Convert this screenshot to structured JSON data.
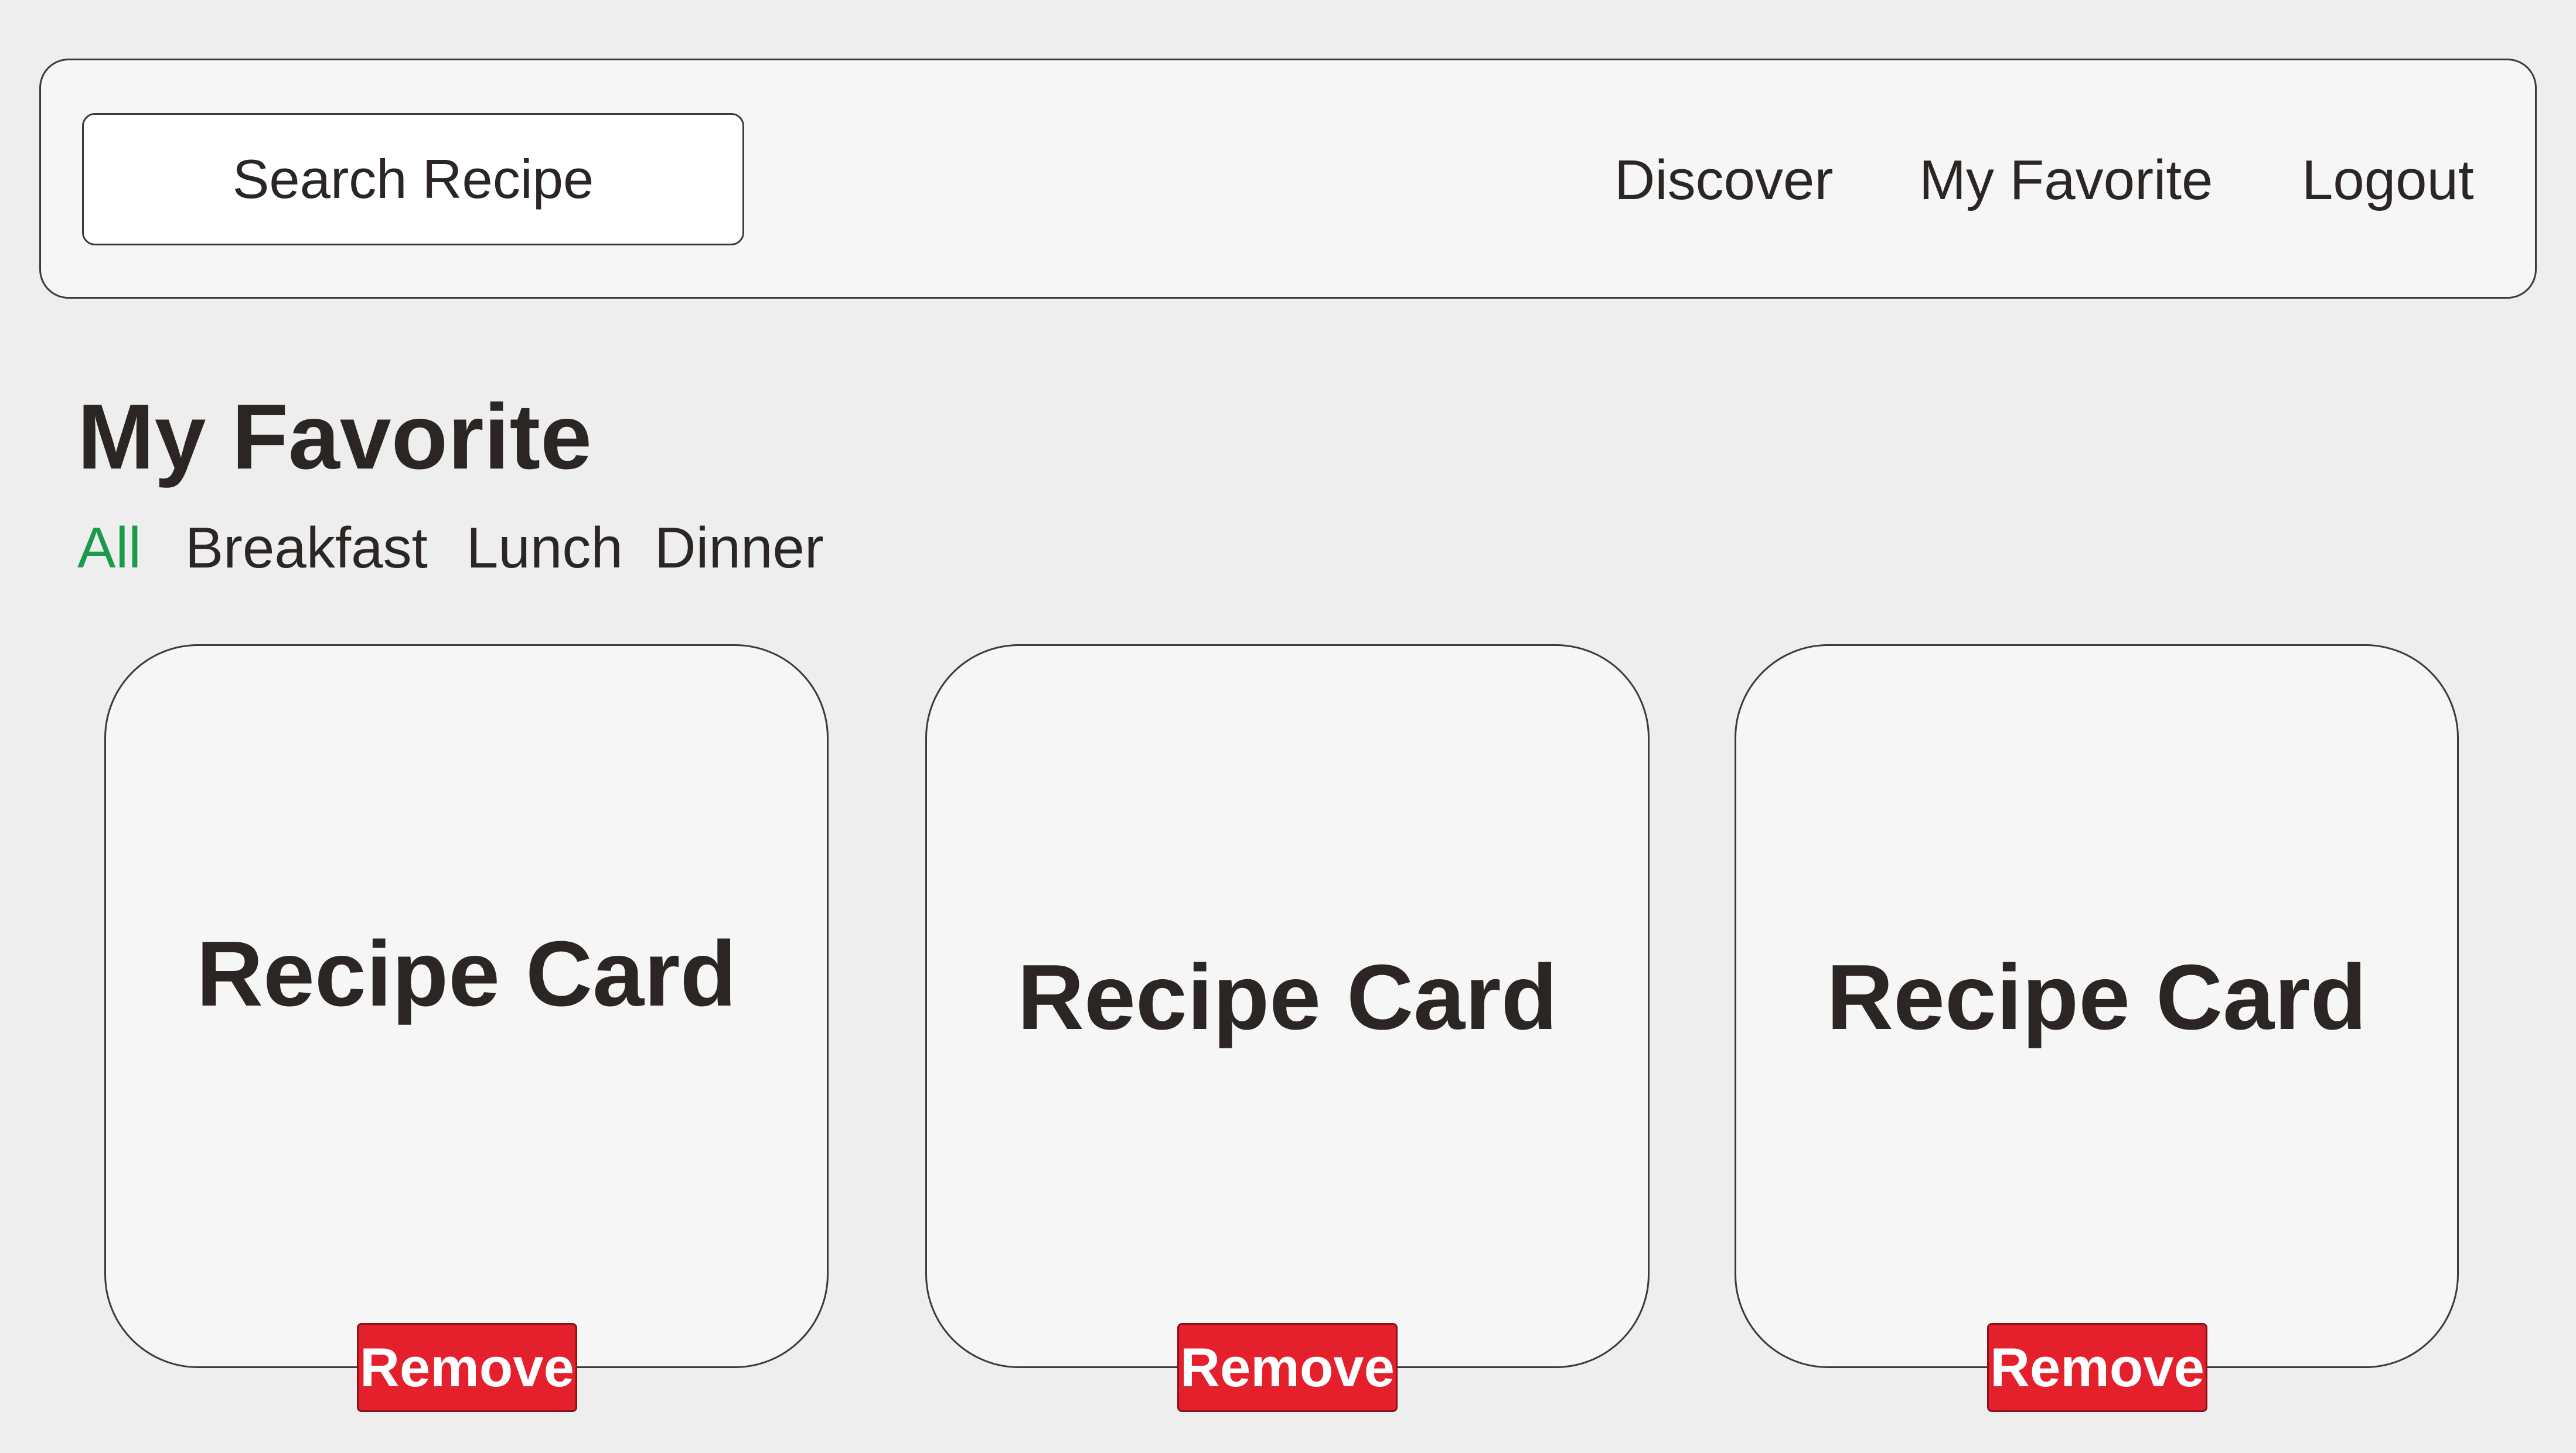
{
  "header": {
    "search_placeholder": "Search Recipe",
    "nav": {
      "discover": "Discover",
      "my_favorite": "My Favorite",
      "logout": "Logout"
    }
  },
  "main": {
    "title": "My Favorite",
    "filters": [
      {
        "label": "All",
        "active": true
      },
      {
        "label": "Breakfast",
        "active": false
      },
      {
        "label": "Lunch",
        "active": false
      },
      {
        "label": "Dinner",
        "active": false
      }
    ],
    "cards": [
      {
        "title": "Recipe Card",
        "action": "Remove"
      },
      {
        "title": "Recipe Card",
        "action": "Remove"
      },
      {
        "title": "Recipe Card",
        "action": "Remove"
      }
    ]
  },
  "colors": {
    "background": "#eeeeee",
    "surface": "#f6f6f6",
    "text": "#2b2523",
    "active_filter": "#1a9a4a",
    "remove_button": "#e3202c"
  }
}
